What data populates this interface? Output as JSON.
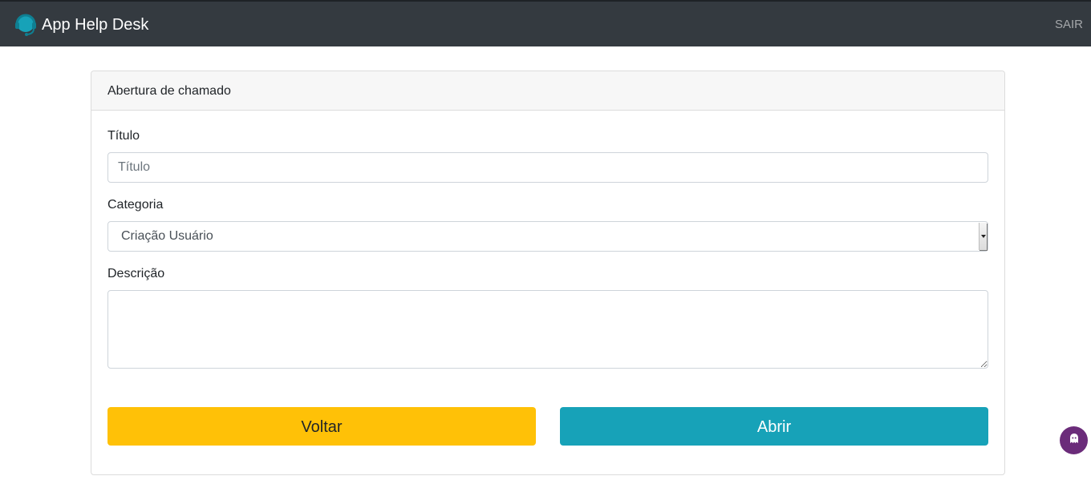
{
  "navbar": {
    "brand_text": "App Help Desk",
    "brand_icon": "headset-icon",
    "logout_label": "SAIR"
  },
  "card": {
    "header_title": "Abertura de chamado"
  },
  "form": {
    "titulo_label": "Título",
    "titulo_placeholder": "Título",
    "titulo_value": "",
    "categoria_label": "Categoria",
    "categoria_selected": "Criação Usuário",
    "descricao_label": "Descrição",
    "descricao_value": ""
  },
  "buttons": {
    "voltar_label": "Voltar",
    "abrir_label": "Abrir"
  },
  "floating_widget": {
    "icon": "ghost-icon"
  },
  "colors": {
    "navbar_bg": "#343a40",
    "brand_icon": "#17a2b8",
    "voltar_bg": "#ffc107",
    "abrir_bg": "#17a2b8",
    "widget_bg": "#6b2c7a"
  }
}
